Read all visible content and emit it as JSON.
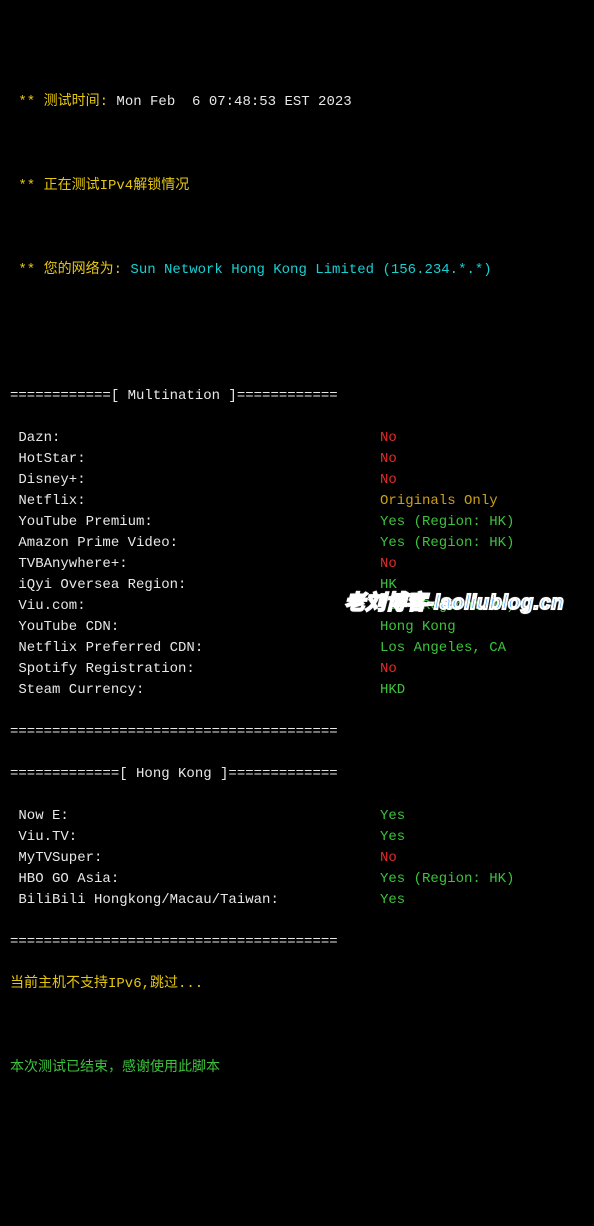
{
  "header": {
    "test_time_label": " ** 测试时间: ",
    "test_time_value": "Mon Feb  6 07:48:53 EST 2023",
    "ipv4_testing": " ** 正在测试IPv4解锁情况",
    "network_label": " ** 您的网络为: ",
    "network_value": "Sun Network Hong Kong Limited (156.234.*.*)"
  },
  "sections": {
    "multination": {
      "divider": "============[ Multination ]============",
      "items": [
        {
          "label": " Dazn:",
          "value": "No",
          "color": "c-red"
        },
        {
          "label": " HotStar:",
          "value": "No",
          "color": "c-red"
        },
        {
          "label": " Disney+:",
          "value": "No",
          "color": "c-red"
        },
        {
          "label": " Netflix:",
          "value": "Originals Only",
          "color": "c-gold"
        },
        {
          "label": " YouTube Premium:",
          "value": "Yes (Region: HK)",
          "color": "c-green"
        },
        {
          "label": " Amazon Prime Video:",
          "value": "Yes (Region: HK)",
          "color": "c-green"
        },
        {
          "label": " TVBAnywhere+:",
          "value": "No",
          "color": "c-red"
        },
        {
          "label": " iQyi Oversea Region:",
          "value": "HK",
          "color": "c-green"
        },
        {
          "label": " Viu.com:",
          "value": "Yes (Region: HK)",
          "color": "c-green"
        },
        {
          "label": " YouTube CDN:",
          "value": "Hong Kong",
          "color": "c-green"
        },
        {
          "label": " Netflix Preferred CDN:",
          "value": "Los Angeles, CA  ",
          "color": "c-green"
        },
        {
          "label": " Spotify Registration:",
          "value": "No",
          "color": "c-red"
        },
        {
          "label": " Steam Currency:",
          "value": "HKD",
          "color": "c-green"
        }
      ],
      "end_divider": "======================================="
    },
    "hongkong": {
      "divider": "=============[ Hong Kong ]=============",
      "items": [
        {
          "label": " Now E:",
          "value": "Yes",
          "color": "c-green"
        },
        {
          "label": " Viu.TV:",
          "value": "Yes",
          "color": "c-green"
        },
        {
          "label": " MyTVSuper:",
          "value": "No",
          "color": "c-red"
        },
        {
          "label": " HBO GO Asia:",
          "value": "Yes (Region: HK)",
          "color": "c-green"
        },
        {
          "label": " BiliBili Hongkong/Macau/Taiwan:",
          "value": "Yes",
          "color": "c-green"
        }
      ],
      "end_divider": "======================================="
    }
  },
  "footer": {
    "ipv6_skip": "当前主机不支持IPv6,跳过...",
    "end_msg": "本次测试已结束，感谢使用此脚本"
  },
  "watermark": "老刘博客-laoliublog.cn"
}
